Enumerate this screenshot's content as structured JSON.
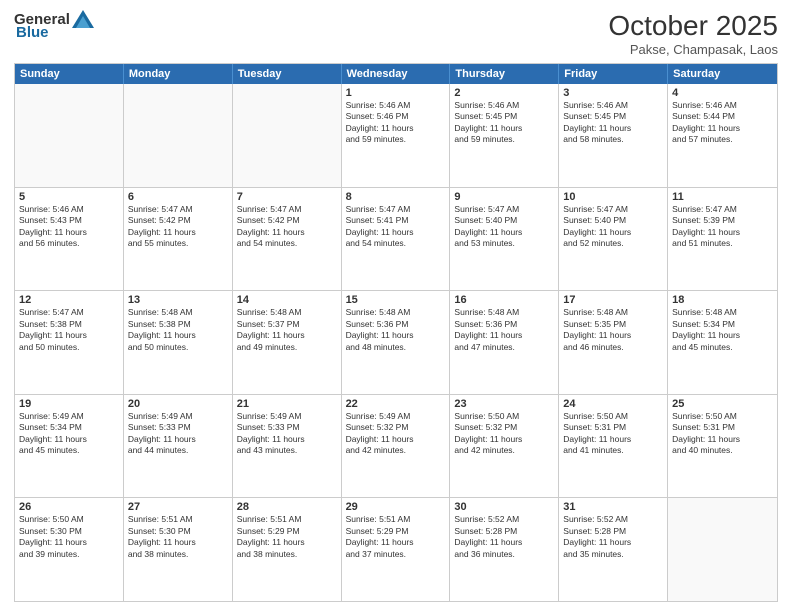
{
  "header": {
    "logo_general": "General",
    "logo_blue": "Blue",
    "month": "October 2025",
    "location": "Pakse, Champasak, Laos"
  },
  "weekdays": [
    "Sunday",
    "Monday",
    "Tuesday",
    "Wednesday",
    "Thursday",
    "Friday",
    "Saturday"
  ],
  "rows": [
    [
      {
        "day": "",
        "info": ""
      },
      {
        "day": "",
        "info": ""
      },
      {
        "day": "",
        "info": ""
      },
      {
        "day": "1",
        "info": "Sunrise: 5:46 AM\nSunset: 5:46 PM\nDaylight: 11 hours\nand 59 minutes."
      },
      {
        "day": "2",
        "info": "Sunrise: 5:46 AM\nSunset: 5:45 PM\nDaylight: 11 hours\nand 59 minutes."
      },
      {
        "day": "3",
        "info": "Sunrise: 5:46 AM\nSunset: 5:45 PM\nDaylight: 11 hours\nand 58 minutes."
      },
      {
        "day": "4",
        "info": "Sunrise: 5:46 AM\nSunset: 5:44 PM\nDaylight: 11 hours\nand 57 minutes."
      }
    ],
    [
      {
        "day": "5",
        "info": "Sunrise: 5:46 AM\nSunset: 5:43 PM\nDaylight: 11 hours\nand 56 minutes."
      },
      {
        "day": "6",
        "info": "Sunrise: 5:47 AM\nSunset: 5:42 PM\nDaylight: 11 hours\nand 55 minutes."
      },
      {
        "day": "7",
        "info": "Sunrise: 5:47 AM\nSunset: 5:42 PM\nDaylight: 11 hours\nand 54 minutes."
      },
      {
        "day": "8",
        "info": "Sunrise: 5:47 AM\nSunset: 5:41 PM\nDaylight: 11 hours\nand 54 minutes."
      },
      {
        "day": "9",
        "info": "Sunrise: 5:47 AM\nSunset: 5:40 PM\nDaylight: 11 hours\nand 53 minutes."
      },
      {
        "day": "10",
        "info": "Sunrise: 5:47 AM\nSunset: 5:40 PM\nDaylight: 11 hours\nand 52 minutes."
      },
      {
        "day": "11",
        "info": "Sunrise: 5:47 AM\nSunset: 5:39 PM\nDaylight: 11 hours\nand 51 minutes."
      }
    ],
    [
      {
        "day": "12",
        "info": "Sunrise: 5:47 AM\nSunset: 5:38 PM\nDaylight: 11 hours\nand 50 minutes."
      },
      {
        "day": "13",
        "info": "Sunrise: 5:48 AM\nSunset: 5:38 PM\nDaylight: 11 hours\nand 50 minutes."
      },
      {
        "day": "14",
        "info": "Sunrise: 5:48 AM\nSunset: 5:37 PM\nDaylight: 11 hours\nand 49 minutes."
      },
      {
        "day": "15",
        "info": "Sunrise: 5:48 AM\nSunset: 5:36 PM\nDaylight: 11 hours\nand 48 minutes."
      },
      {
        "day": "16",
        "info": "Sunrise: 5:48 AM\nSunset: 5:36 PM\nDaylight: 11 hours\nand 47 minutes."
      },
      {
        "day": "17",
        "info": "Sunrise: 5:48 AM\nSunset: 5:35 PM\nDaylight: 11 hours\nand 46 minutes."
      },
      {
        "day": "18",
        "info": "Sunrise: 5:48 AM\nSunset: 5:34 PM\nDaylight: 11 hours\nand 45 minutes."
      }
    ],
    [
      {
        "day": "19",
        "info": "Sunrise: 5:49 AM\nSunset: 5:34 PM\nDaylight: 11 hours\nand 45 minutes."
      },
      {
        "day": "20",
        "info": "Sunrise: 5:49 AM\nSunset: 5:33 PM\nDaylight: 11 hours\nand 44 minutes."
      },
      {
        "day": "21",
        "info": "Sunrise: 5:49 AM\nSunset: 5:33 PM\nDaylight: 11 hours\nand 43 minutes."
      },
      {
        "day": "22",
        "info": "Sunrise: 5:49 AM\nSunset: 5:32 PM\nDaylight: 11 hours\nand 42 minutes."
      },
      {
        "day": "23",
        "info": "Sunrise: 5:50 AM\nSunset: 5:32 PM\nDaylight: 11 hours\nand 42 minutes."
      },
      {
        "day": "24",
        "info": "Sunrise: 5:50 AM\nSunset: 5:31 PM\nDaylight: 11 hours\nand 41 minutes."
      },
      {
        "day": "25",
        "info": "Sunrise: 5:50 AM\nSunset: 5:31 PM\nDaylight: 11 hours\nand 40 minutes."
      }
    ],
    [
      {
        "day": "26",
        "info": "Sunrise: 5:50 AM\nSunset: 5:30 PM\nDaylight: 11 hours\nand 39 minutes."
      },
      {
        "day": "27",
        "info": "Sunrise: 5:51 AM\nSunset: 5:30 PM\nDaylight: 11 hours\nand 38 minutes."
      },
      {
        "day": "28",
        "info": "Sunrise: 5:51 AM\nSunset: 5:29 PM\nDaylight: 11 hours\nand 38 minutes."
      },
      {
        "day": "29",
        "info": "Sunrise: 5:51 AM\nSunset: 5:29 PM\nDaylight: 11 hours\nand 37 minutes."
      },
      {
        "day": "30",
        "info": "Sunrise: 5:52 AM\nSunset: 5:28 PM\nDaylight: 11 hours\nand 36 minutes."
      },
      {
        "day": "31",
        "info": "Sunrise: 5:52 AM\nSunset: 5:28 PM\nDaylight: 11 hours\nand 35 minutes."
      },
      {
        "day": "",
        "info": ""
      }
    ]
  ]
}
